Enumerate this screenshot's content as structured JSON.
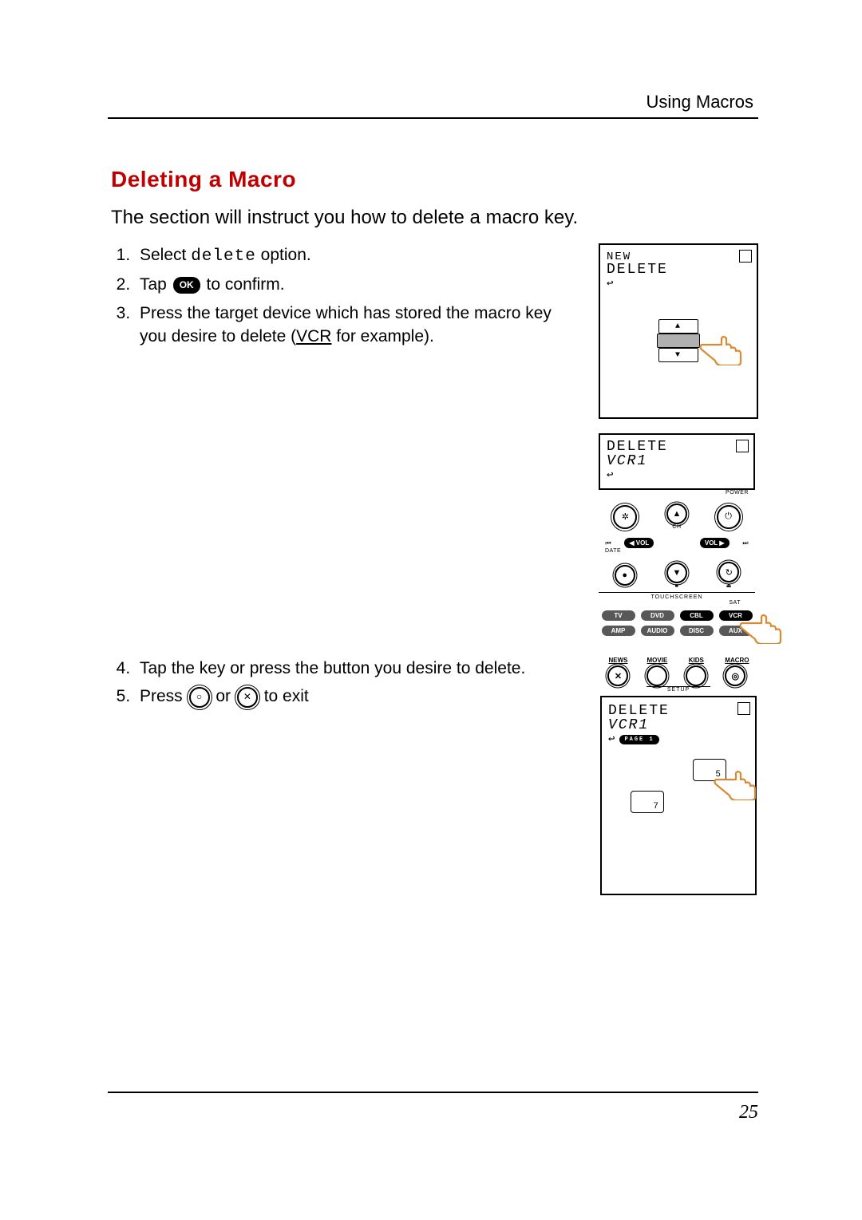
{
  "header": {
    "running": "Using Macros"
  },
  "section": {
    "title": "Deleting a Macro"
  },
  "intro": "The section will instruct you how to delete a macro key.",
  "steps_a": {
    "s1_pre": "Select ",
    "s1_code": "delete",
    "s1_post": " option.",
    "s2_pre": "Tap ",
    "s2_btn": "OK",
    "s2_post": " to confirm.",
    "s3_pre": "Press the target device which has stored the macro key you desire to delete (",
    "s3_u": "VCR",
    "s3_post": " for example)."
  },
  "steps_b": {
    "s4": "Tap the key or press the button you desire to delete.",
    "s5_pre": "Press ",
    "s5_btn1": "○",
    "s5_mid": " or ",
    "s5_btn2": "✕",
    "s5_post": " to exit"
  },
  "fig1": {
    "line1": "NEW",
    "line2": "DELETE",
    "arrow_up": "▲",
    "arrow_dn": "▼"
  },
  "fig2": {
    "lcd1": "DELETE",
    "lcd2": "VCR1",
    "labels": {
      "power": "POWER",
      "date": "DATE",
      "ch": "CH",
      "touchscreen": "TOUCHSCREEN",
      "sat": "SAT"
    },
    "vol_minus": "◀ VOL",
    "vol_plus": "VOL ▶",
    "prev_track": "⏮",
    "next_track": "⏭",
    "devices_row1": [
      "TV",
      "DVD",
      "CBL",
      "VCR"
    ],
    "devices_row2": [
      "AMP",
      "AUDIO",
      "DISC",
      "AUX"
    ],
    "power_glyph": "⏻",
    "gear": "✲",
    "ch_up": "▲",
    "ch_dn": "▼",
    "stop": "■",
    "rec": "●",
    "repeat": "↻",
    "eject": "⏏"
  },
  "fig3": {
    "macro_cols": [
      "NEWS",
      "MOVIE",
      "KIDS",
      "MACRO"
    ],
    "setup": "SETUP",
    "lcd1": "DELETE",
    "lcd2": "VCR1",
    "page": "PAGE 1",
    "keys": {
      "k5": "5",
      "k7": "7"
    }
  },
  "page_number": "25"
}
